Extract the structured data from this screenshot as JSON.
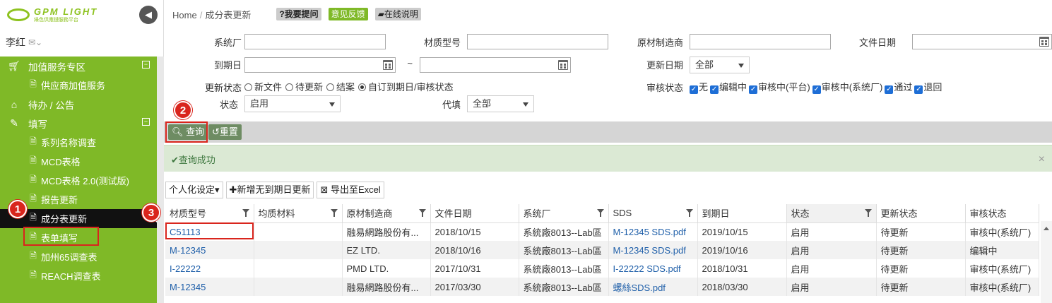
{
  "brand": {
    "name": "GPM LIGHT",
    "sub": "綠色供應鏈服務平台"
  },
  "user": {
    "name": "李红"
  },
  "sidebar": {
    "items": [
      {
        "label": "加值服务专区",
        "type": "group",
        "icon": "cart-icon",
        "fold": "⊟"
      },
      {
        "label": "供应商加值服务",
        "type": "sub"
      },
      {
        "label": "待办 / 公告",
        "type": "group",
        "icon": "home-icon"
      },
      {
        "label": "填写",
        "type": "group",
        "icon": "edit-icon",
        "fold": "⊟"
      },
      {
        "label": "系列名称调查",
        "type": "sub"
      },
      {
        "label": "MCD表格",
        "type": "sub"
      },
      {
        "label": "MCD表格 2.0(测试版)",
        "type": "sub"
      },
      {
        "label": "报告更新",
        "type": "sub"
      },
      {
        "label": "成分表更新",
        "type": "sub",
        "active": true
      },
      {
        "label": "表单填写",
        "type": "sub"
      },
      {
        "label": "加州65调查表",
        "type": "sub"
      },
      {
        "label": "REACH调查表",
        "type": "sub"
      }
    ]
  },
  "breadcrumb": {
    "home": "Home",
    "sep": "/",
    "current": "成分表更新"
  },
  "topbar": {
    "ask": "?我要提问",
    "feedback": "意见反馈",
    "help": "在线说明"
  },
  "filters": {
    "factory_label": "系统厂",
    "material_label": "材质型号",
    "manufacturer_label": "原材制造商",
    "docdate_label": "文件日期",
    "expiry_label": "到期日",
    "range_sep": "~",
    "updatedate_label": "更新日期",
    "updatedate_value": "全部",
    "updatestatus_label": "更新状态",
    "updatestatus_options": [
      "新文件",
      "待更新",
      "结案",
      "自订到期日/审核状态"
    ],
    "updatestatus_selected": 3,
    "review_label": "审核状态",
    "review_options": [
      "无",
      "编辑中",
      "审核中(平台)",
      "审核中(系统厂)",
      "通过",
      "退回"
    ],
    "status_label": "状态",
    "status_value": "启用",
    "proxy_label": "代填",
    "proxy_value": "全部"
  },
  "actions": {
    "search": "查询",
    "reset": "重置"
  },
  "alert": {
    "text": "查询成功",
    "close": "×"
  },
  "tools": {
    "personalize": "个人化设定",
    "add": "新增无到期日更新",
    "export": "导出至Excel"
  },
  "table": {
    "headers": [
      "材质型号",
      "均质材料",
      "原材制造商",
      "文件日期",
      "系统厂",
      "SDS",
      "到期日",
      "状态",
      "更新状态",
      "审核状态"
    ],
    "rows": [
      [
        "C51113",
        "",
        "融易網路股份有...",
        "2018/10/15",
        "系統廠8013--Lab區",
        "M-12345 SDS.pdf",
        "2019/10/15",
        "启用",
        "待更新",
        "审核中(系统厂)"
      ],
      [
        "M-12345",
        "",
        "EZ LTD.",
        "2018/10/16",
        "系統廠8013--Lab區",
        "M-12345 SDS.pdf",
        "2019/10/16",
        "启用",
        "待更新",
        "编辑中"
      ],
      [
        "I-22222",
        "",
        "PMD LTD.",
        "2017/10/31",
        "系統廠8013--Lab區",
        "I-22222 SDS.pdf",
        "2018/10/31",
        "启用",
        "待更新",
        "审核中(系统厂)"
      ],
      [
        "M-12345",
        "",
        "融易網路股份有...",
        "2017/03/30",
        "系統廠8013--Lab區",
        "螺絲SDS.pdf",
        "2018/03/30",
        "启用",
        "待更新",
        "审核中(系统厂)"
      ]
    ]
  },
  "callouts": [
    "1",
    "2",
    "3"
  ],
  "colors": {
    "brand_green": "#7fb927",
    "highlight_red": "#d9251d",
    "link_blue": "#1f5fa9"
  }
}
